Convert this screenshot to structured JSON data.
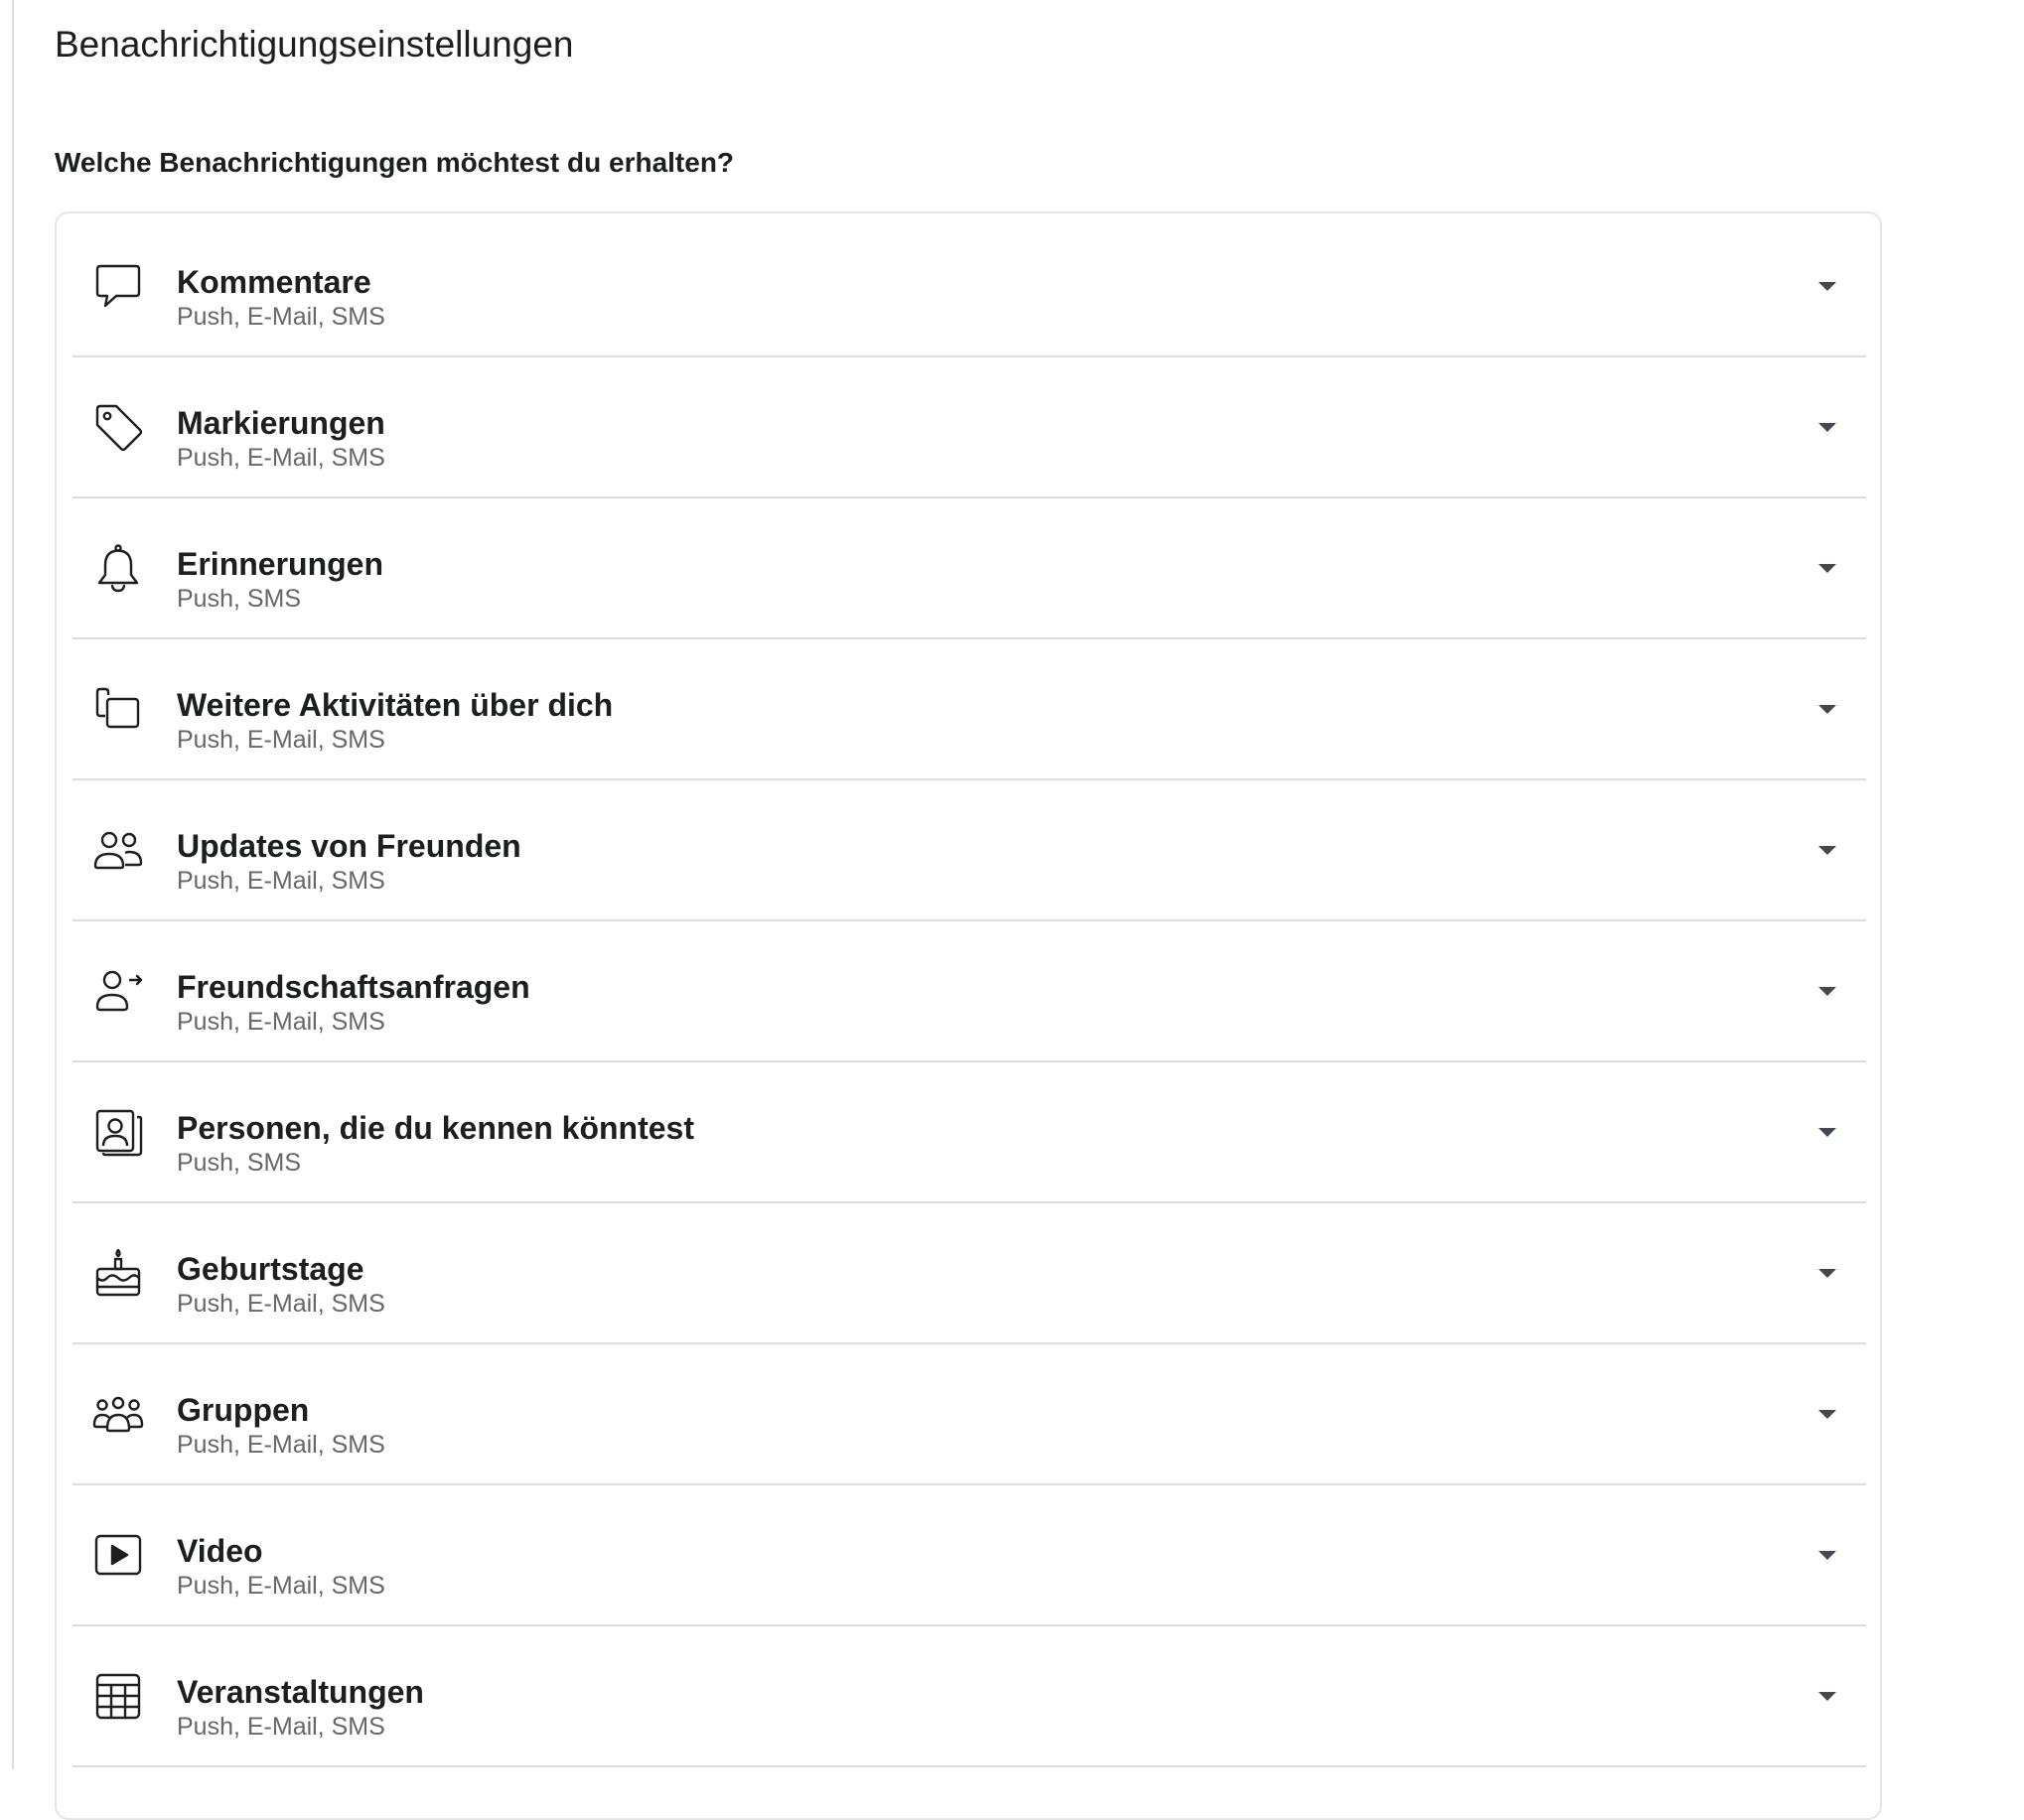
{
  "page": {
    "title": "Benachrichtigungseinstellungen",
    "question": "Welche Benachrichtigungen möchtest du erhalten?"
  },
  "settings": [
    {
      "icon": "comment-icon",
      "label": "Kommentare",
      "channels": "Push, E-Mail, SMS"
    },
    {
      "icon": "tag-icon",
      "label": "Markierungen",
      "channels": "Push, E-Mail, SMS"
    },
    {
      "icon": "bell-icon",
      "label": "Erinnerungen",
      "channels": "Push, SMS"
    },
    {
      "icon": "activity-icon",
      "label": "Weitere Aktivitäten über dich",
      "channels": "Push, E-Mail, SMS"
    },
    {
      "icon": "friends-icon",
      "label": "Updates von Freunden",
      "channels": "Push, E-Mail, SMS"
    },
    {
      "icon": "friend-request-icon",
      "label": "Freundschaftsanfragen",
      "channels": "Push, E-Mail, SMS"
    },
    {
      "icon": "people-suggestions-icon",
      "label": "Personen, die du kennen könntest",
      "channels": "Push, SMS"
    },
    {
      "icon": "cake-icon",
      "label": "Geburtstage",
      "channels": "Push, E-Mail, SMS"
    },
    {
      "icon": "groups-icon",
      "label": "Gruppen",
      "channels": "Push, E-Mail, SMS"
    },
    {
      "icon": "video-icon",
      "label": "Video",
      "channels": "Push, E-Mail, SMS"
    },
    {
      "icon": "calendar-icon",
      "label": "Veranstaltungen",
      "channels": "Push, E-Mail, SMS"
    }
  ],
  "colors": {
    "text_primary": "#1c1e21",
    "text_secondary": "#65676b",
    "divider": "#dadde1",
    "icon": "#1c1e21",
    "caret": "#444950"
  }
}
